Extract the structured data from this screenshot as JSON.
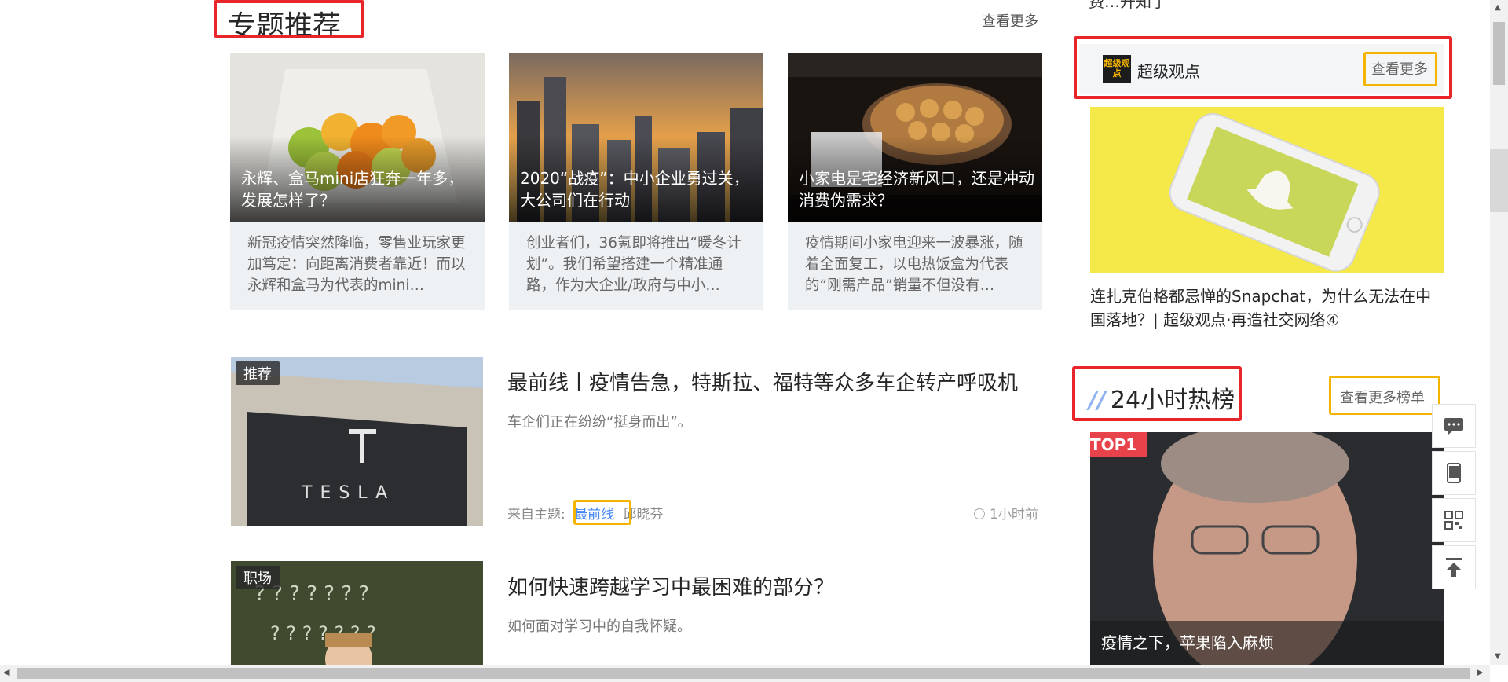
{
  "topics_section": {
    "title": "专题推荐",
    "see_more": "查看更多",
    "cards": [
      {
        "title": "永辉、盒马mini店狂奔一年多，发展怎样了？",
        "desc": "新冠疫情突然降临，零售业玩家更加笃定：向距离消费者靠近！而以永辉和盒马为代表的mini…"
      },
      {
        "title": "2020“战疫”：中小企业勇过关，大公司们在行动",
        "desc": "创业者们，36氪即将推出“暖冬计划”。我们希望搭建一个精准通路，作为大企业/政府与中小…"
      },
      {
        "title": "小家电是宅经济新风口，还是冲动消费伪需求？",
        "desc": "疫情期间小家电迎来一波暴涨，随着全面复工，以电热饭盒为代表的“刚需产品”销量不但没有…"
      }
    ]
  },
  "articles": [
    {
      "tag": "推荐",
      "title": "最前线丨疫情告急，特斯拉、福特等众多车企转产呼吸机",
      "summary": "车企们正在纷纷“挺身而出”。",
      "source_label": "来自主题:",
      "topic": "最前线",
      "author": "邱晓芬",
      "time": "1小时前",
      "image_text": "TESLA"
    },
    {
      "tag": "职场",
      "title": "如何快速跨越学习中最困难的部分？",
      "summary": "如何面对学习中的自我怀疑。"
    }
  ],
  "sidebar": {
    "top_cut_text": "费…开知了",
    "sponsor": {
      "logo_text": "超级观点",
      "name": "超级观点",
      "see_more": "查看更多",
      "article_title": "连扎克伯格都忌惮的Snapchat，为什么无法在中国落地？| 超级观点·再造社交网络④"
    },
    "hot_list": {
      "title": "24小时热榜",
      "see_more": "查看更多榜单",
      "top_badge": "TOP1",
      "top_title": "疫情之下，苹果陷入麻烦"
    }
  },
  "float_tools": [
    "comment-icon",
    "mobile-icon",
    "qr-code-icon",
    "back-to-top-icon"
  ],
  "colors": {
    "annotation_red": "#e8262a",
    "annotation_orange": "#f4b400",
    "link_blue": "#4285f4",
    "top_badge": "#e8424a"
  }
}
